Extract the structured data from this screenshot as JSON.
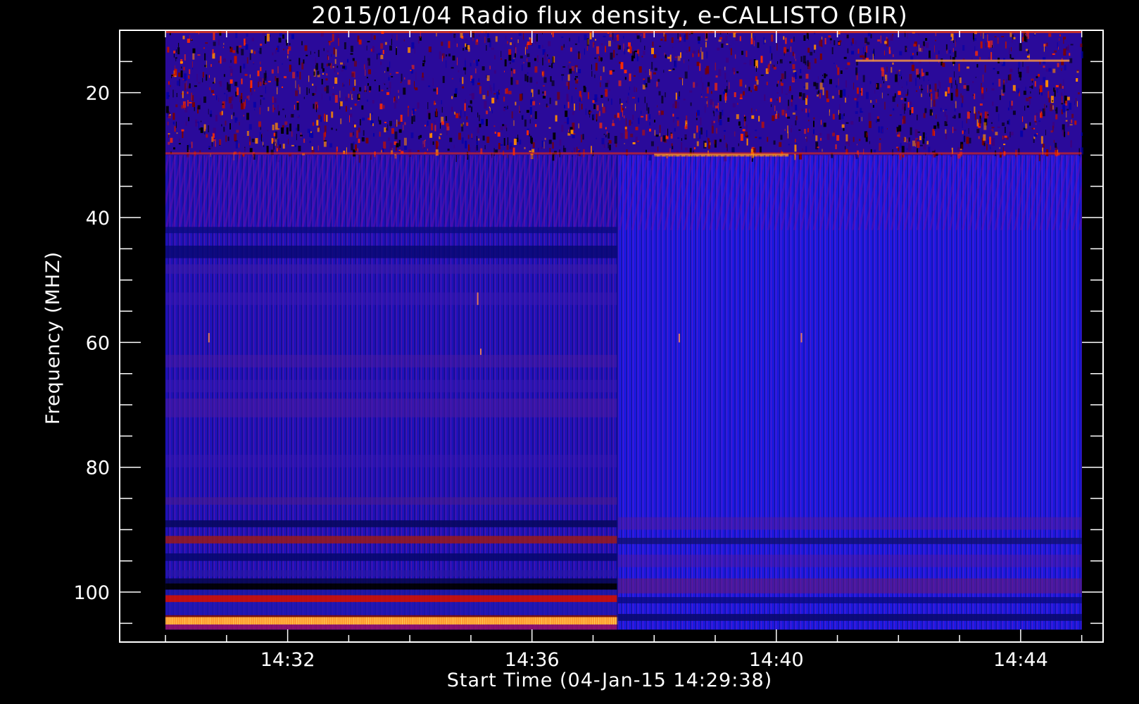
{
  "chart_data": {
    "type": "heatmap",
    "title": "2015/01/04  Radio flux density, e-CALLISTO (BIR)",
    "xlabel": "Start Time (04-Jan-15 14:29:38)",
    "ylabel": "Frequency (MHZ)",
    "x_tick_labels": [
      "14:32",
      "14:36",
      "14:40",
      "14:44"
    ],
    "x_tick_values_min": [
      872,
      876,
      880,
      884
    ],
    "y_tick_labels": [
      "20",
      "40",
      "60",
      "80",
      "100"
    ],
    "y_tick_values": [
      20,
      40,
      60,
      80,
      100
    ],
    "xlim_min": [
      869.25,
      885.35
    ],
    "ylim": [
      10,
      108
    ],
    "y_inverted": true,
    "data_time_range_min": [
      870.0,
      885.0
    ],
    "data_freq_range_mhz": [
      10,
      106
    ],
    "colormap": [
      "#000000",
      "#0000ff",
      "#ff0000",
      "#ffff00"
    ],
    "background": "#000000",
    "features": {
      "noisy_band_mhz": [
        10,
        30
      ],
      "receiver_switch_time_min": 877.4,
      "bright_band_mhz": [
        104,
        105.2
      ]
    }
  }
}
